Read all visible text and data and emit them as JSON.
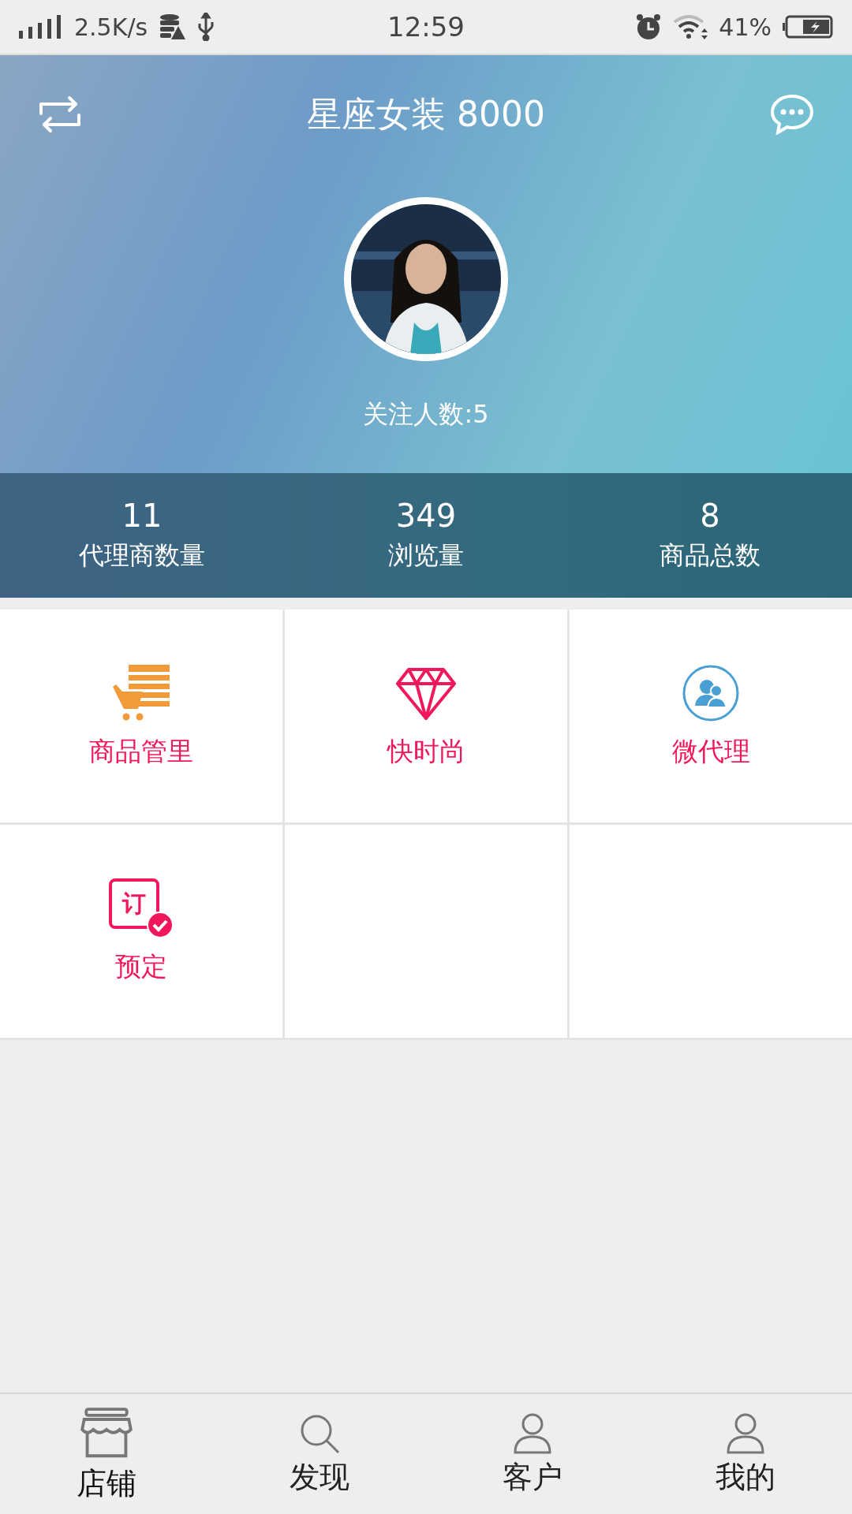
{
  "status_bar": {
    "net_speed": "2.5K/s",
    "time": "12:59",
    "battery": "41%"
  },
  "header": {
    "title": "星座女装 8000",
    "followers": "关注人数:5"
  },
  "stats": [
    {
      "value": "11",
      "label": "代理商数量"
    },
    {
      "value": "349",
      "label": "浏览量"
    },
    {
      "value": "8",
      "label": "商品总数"
    }
  ],
  "tiles": [
    {
      "kind": "cart",
      "label": "商品管里"
    },
    {
      "kind": "diamond",
      "label": "快时尚"
    },
    {
      "kind": "agents",
      "label": "微代理"
    },
    {
      "kind": "order",
      "label": "预定",
      "glyph": "订"
    }
  ],
  "tabs": [
    {
      "kind": "store",
      "label": "店铺",
      "selected": true
    },
    {
      "kind": "search",
      "label": "发现",
      "selected": false
    },
    {
      "kind": "person",
      "label": "客户",
      "selected": false
    },
    {
      "kind": "person",
      "label": "我的",
      "selected": false
    }
  ]
}
